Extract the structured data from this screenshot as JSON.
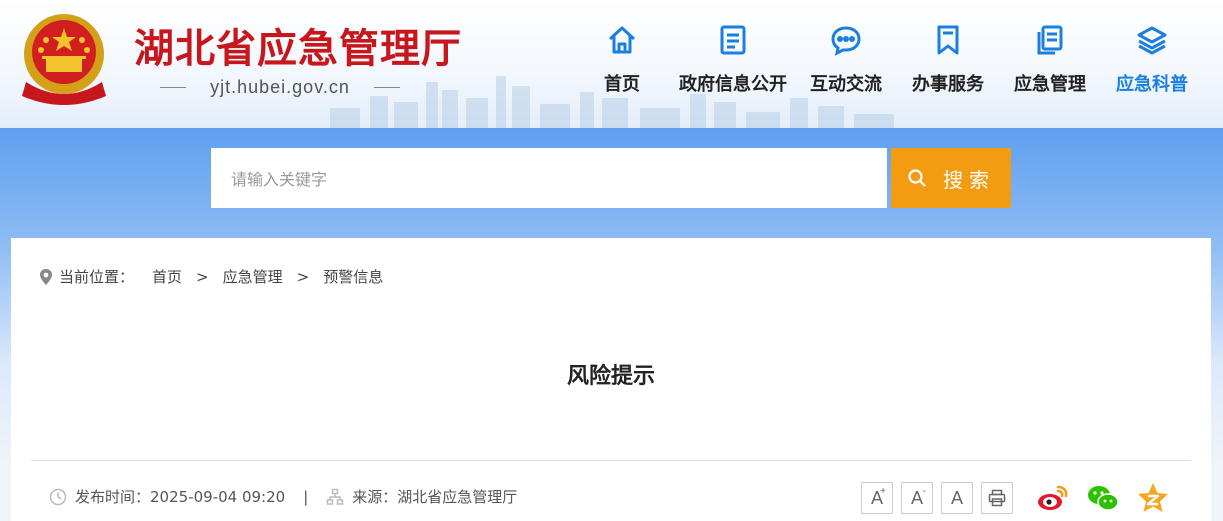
{
  "header": {
    "site_title": "湖北省应急管理厅",
    "site_url": "yjt.hubei.gov.cn"
  },
  "nav": [
    {
      "label": "首页",
      "icon": "home-icon"
    },
    {
      "label": "政府信息公开",
      "icon": "document-icon"
    },
    {
      "label": "互动交流",
      "icon": "chat-icon"
    },
    {
      "label": "办事服务",
      "icon": "bookmark-icon"
    },
    {
      "label": "应急管理",
      "icon": "files-icon"
    },
    {
      "label": "应急科普",
      "icon": "layers-icon",
      "active": true
    }
  ],
  "search": {
    "placeholder": "请输入关键字",
    "button_label": "搜索"
  },
  "breadcrumb": {
    "label": "当前位置：",
    "items": [
      "首页",
      "应急管理",
      "预警信息"
    ],
    "separator": ">"
  },
  "article": {
    "title": "风险提示",
    "publish_label": "发布时间：",
    "publish_time": "2025-09-04 09:20",
    "source_label": "来源：",
    "source": "湖北省应急管理厅"
  },
  "tools": {
    "font_larger": "A",
    "font_larger_mark": "+",
    "font_smaller": "A",
    "font_smaller_mark": "-",
    "font_default": "A"
  },
  "colors": {
    "brand_red": "#c8161d",
    "nav_active": "#1b7fe0",
    "search_button": "#f39c12"
  }
}
